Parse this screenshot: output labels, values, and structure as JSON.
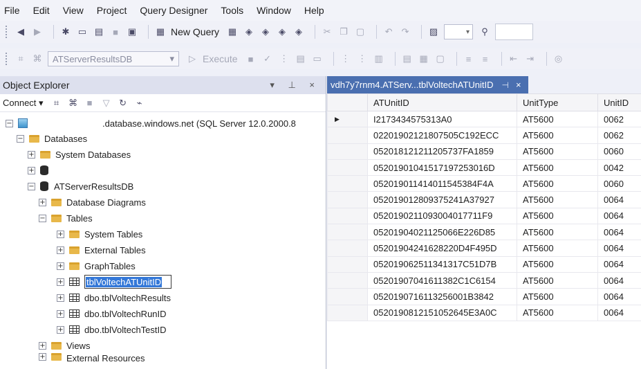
{
  "menu": [
    "File",
    "Edit",
    "View",
    "Project",
    "Query Designer",
    "Tools",
    "Window",
    "Help"
  ],
  "toolbar1": {
    "new_query_label": "New Query"
  },
  "toolbar2": {
    "database": "ATServerResultsDB",
    "execute_label": "Execute"
  },
  "object_explorer": {
    "title": "Object Explorer",
    "title_controls": "▾ ⊥ ×",
    "connect_label": "Connect",
    "server_label": ".database.windows.net (SQL Server 12.0.2000.8",
    "databases_label": "Databases",
    "system_databases": "System Databases",
    "db_name": "ATServerResultsDB",
    "database_diagrams": "Database Diagrams",
    "tables_label": "Tables",
    "system_tables": "System Tables",
    "external_tables": "External Tables",
    "graph_tables": "GraphTables",
    "rename_value": "tblVoltechATUnitID",
    "table2": "dbo.tblVoltechResults",
    "table3": "dbo.tblVoltechRunID",
    "table4": "dbo.tblVoltechTestID",
    "views_label": "Views",
    "external_resources": "External Resources"
  },
  "doc_tab": {
    "label": "vdh7y7rnm4.ATServ...tblVoltechATUnitID",
    "pin": "⊣",
    "close": "×"
  },
  "grid": {
    "columns": [
      "ATUnitID",
      "UnitType",
      "UnitID"
    ],
    "rows": [
      [
        "I2173434575313A0",
        "AT5600",
        "0062"
      ],
      [
        "02201902121807505C192ECC",
        "AT5600",
        "0062"
      ],
      [
        "052018121211205737FA1859",
        "AT5600",
        "0060"
      ],
      [
        "052019010415171972530 16D",
        "AT5600",
        "0042"
      ],
      [
        "052019011414011545384F4A",
        "AT5600",
        "0060"
      ],
      [
        "052019012809375241A37927",
        "AT5600",
        "0064"
      ],
      [
        "052019021109300 4017711F9",
        "AT5600",
        "0064"
      ],
      [
        "052019040211250 66E226D85",
        "AT5600",
        "0064"
      ],
      [
        "052019042416282 20D4F495D",
        "AT5600",
        "0064"
      ],
      [
        "0520190625113413 17C51D7B",
        "AT5600",
        "0064"
      ],
      [
        "052019070416113 82C1C6154",
        "AT5600",
        "0064"
      ],
      [
        "0520190716113256001B3842",
        "AT5600",
        "0064"
      ],
      [
        "052019081215105264 5E3A0C",
        "AT5600",
        "0064"
      ]
    ],
    "current_row_marker": "▶"
  }
}
